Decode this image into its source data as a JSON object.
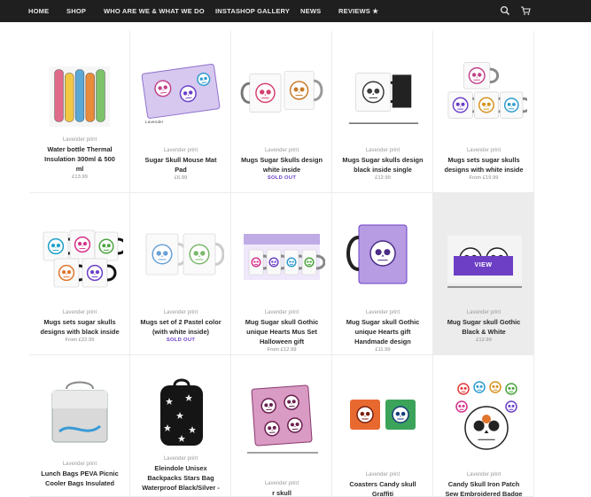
{
  "nav": {
    "items": [
      {
        "label": "HOME",
        "name": "nav-home"
      },
      {
        "label": "SHOP",
        "name": "nav-shop"
      },
      {
        "label": "WHO ARE WE & WHAT WE DO",
        "name": "nav-about"
      },
      {
        "label": "INSTASHOP GALLERY",
        "name": "nav-instashop"
      },
      {
        "label": "NEWS",
        "name": "nav-news"
      },
      {
        "label": "REVIEWS ★",
        "name": "nav-reviews"
      }
    ],
    "search_icon": "search-icon",
    "cart_icon": "cart-icon"
  },
  "products": [
    {
      "vendor": "Lavender print",
      "title_lines": [
        "Water bottle Thermal",
        "Insulation 300ml & 500",
        "ml"
      ],
      "price": "£13.99",
      "sold_out": "",
      "thumb": "bottles"
    },
    {
      "vendor": "Lavender print",
      "title_lines": [
        "Sugar Skull Mouse Mat",
        "Pad"
      ],
      "price": "£6.99",
      "sold_out": "",
      "thumb": "mousemat"
    },
    {
      "vendor": "Lavender print",
      "title_lines": [
        "Mugs Sugar Skulls design",
        "white inside"
      ],
      "price": "",
      "sold_out": "SOLD OUT",
      "thumb": "mugs-white"
    },
    {
      "vendor": "Lavender print",
      "title_lines": [
        "Mugs Sugar skulls design",
        "black inside single"
      ],
      "price": "£12.99",
      "sold_out": "",
      "thumb": "mugs-black"
    },
    {
      "vendor": "Lavender print",
      "title_lines": [
        "Mugs sets sugar skulls",
        "designs with white inside"
      ],
      "price": "From £19.99",
      "sold_out": "",
      "thumb": "mugs-set-white"
    },
    {
      "vendor": "Lavender print",
      "title_lines": [
        "Mugs sets sugar skulls",
        "designs with black inside"
      ],
      "price": "From £22.99",
      "sold_out": "",
      "thumb": "mugs-set-black"
    },
    {
      "vendor": "Lavender print",
      "title_lines": [
        "Mugs set of 2 Pastel color",
        "(with white inside)"
      ],
      "price": "",
      "sold_out": "SOLD OUT",
      "thumb": "mugs-pastel"
    },
    {
      "vendor": "Lavender print",
      "title_lines": [
        "Mug Sugar skull Gothic",
        "unique Hearts Mus Set",
        "Halloween gift"
      ],
      "price": "From £12.99",
      "sold_out": "",
      "thumb": "mugs-gothic"
    },
    {
      "vendor": "Lavender print",
      "title_lines": [
        "Mug Sugar skull Gothic",
        "unique Hearts gift",
        "Handmade design"
      ],
      "price": "£11.99",
      "sold_out": "",
      "thumb": "mug-purple"
    },
    {
      "vendor": "Lavender print",
      "title_lines": [
        "Mug Sugar skull Gothic",
        "Black & White"
      ],
      "price": "£12.99",
      "sold_out": "",
      "thumb": "mug-bw",
      "view": "VIEW"
    },
    {
      "vendor": "Lavender print",
      "title_lines": [
        "Lunch Bags PEVA Picnic",
        "Cooler Bags Insulated"
      ],
      "price": "",
      "sold_out": "",
      "thumb": "lunchbag"
    },
    {
      "vendor": "Lavender print",
      "title_lines": [
        "Eleindole Unisex",
        "Backpacks Stars Bag",
        "Waterproof Black/Silver -"
      ],
      "price": "",
      "sold_out": "",
      "thumb": "backpack"
    },
    {
      "vendor": "Lavender print",
      "title_lines": [
        "r skull"
      ],
      "price": "",
      "sold_out": "",
      "thumb": "mat-pink"
    },
    {
      "vendor": "Lavender print",
      "title_lines": [
        "Coasters Candy skull",
        "Graffiti"
      ],
      "price": "",
      "sold_out": "",
      "thumb": "coasters"
    },
    {
      "vendor": "Lavender print",
      "title_lines": [
        "Candy Skull Iron Patch",
        "Sew Embroidered Badge"
      ],
      "price": "",
      "sold_out": "",
      "thumb": "patch"
    }
  ],
  "colors": {
    "nav_bg": "#1f1f1f",
    "accent": "#6c3fc5",
    "sold_out": "#6b40c8"
  }
}
